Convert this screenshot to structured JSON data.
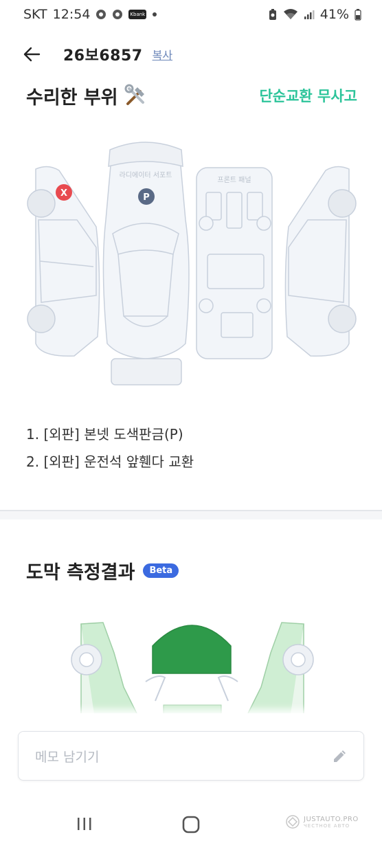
{
  "status_bar": {
    "carrier": "SKT",
    "time": "12:54",
    "battery": "41%"
  },
  "header": {
    "plate_number": "26보6857",
    "copy_label": "복사"
  },
  "repair_section": {
    "title": "수리한 부위",
    "status": "단순교환 무사고",
    "diagram_labels": {
      "radiator": "라디에이터 서포트",
      "front_panel": "프론트 패널"
    },
    "markers": {
      "exchange": "X",
      "paint": "P"
    },
    "items": [
      "1. [외판] 본넷 도색판금(P)",
      "2. [외판] 운전석 앞휀다 교환"
    ],
    "colors": {
      "status": "#2cc49a",
      "exchange_marker": "#e84a4f",
      "paint_marker": "#5a6a86"
    }
  },
  "paint_section": {
    "title": "도막 측정결과",
    "badge": "Beta",
    "colors": {
      "badge": "#3b6ae0",
      "hood": "#2e9a4a",
      "light_green": "#cfeed3"
    }
  },
  "memo": {
    "placeholder": "메모 남기기"
  },
  "watermark": {
    "text": "JUSTAUTO.PRO",
    "subtext": "ЧЕСТНОЕ АВТО"
  }
}
